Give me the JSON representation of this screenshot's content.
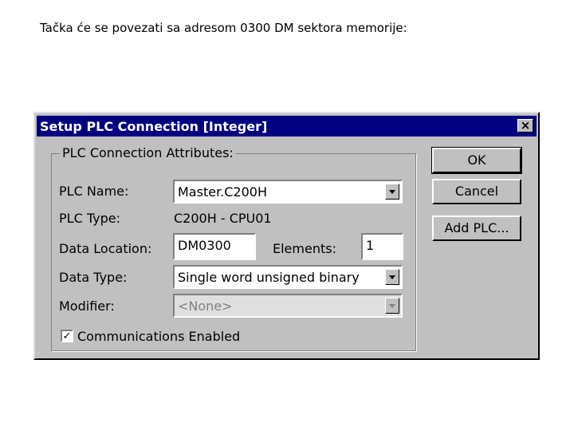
{
  "caption": "Tačka će se povezati sa adresom 0300 DM sektora memorije:",
  "dialog": {
    "title": "Setup PLC Connection  [Integer]",
    "close_glyph": "×",
    "group_label": "PLC Connection Attributes:",
    "plc_name_label": "PLC Name:",
    "plc_name_value": "Master.C200H",
    "plc_type_label": "PLC Type:",
    "plc_type_value": "C200H - CPU01",
    "data_location_label": "Data Location:",
    "data_location_value": "DM0300",
    "elements_label": "Elements:",
    "elements_value": "1",
    "data_type_label": "Data Type:",
    "data_type_value": "Single word unsigned binary",
    "modifier_label": "Modifier:",
    "modifier_value": "<None>",
    "comms_label": "Communications Enabled",
    "comms_checked": true,
    "check_glyph": "✓",
    "ok_label": "OK",
    "cancel_label": "Cancel",
    "add_plc_label": "Add PLC..."
  },
  "colors": {
    "title_bar": "#000080",
    "dialog_face": "#c0c0c0"
  }
}
